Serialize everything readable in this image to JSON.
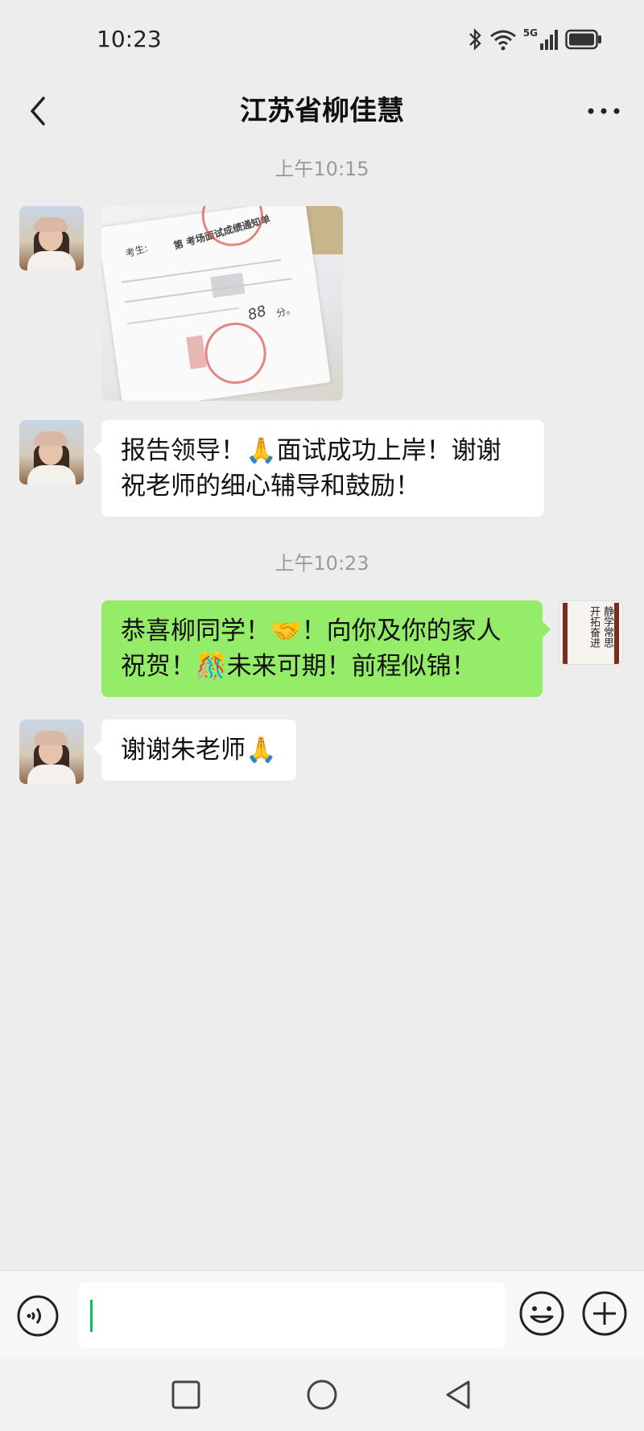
{
  "status_bar": {
    "time": "10:23",
    "network": "5G"
  },
  "header": {
    "title": "江苏省柳佳慧"
  },
  "messages": [
    {
      "type": "timestamp",
      "text": "上午10:15"
    },
    {
      "type": "image",
      "sender": "contact",
      "doc_text": {
        "candidate": "考生:",
        "heading": "第 考场面试成绩通知单",
        "score": "88",
        "unit": "分。"
      }
    },
    {
      "type": "text",
      "sender": "contact",
      "text": "报告领导！🙏面试成功上岸！谢谢祝老师的细心辅导和鼓励！"
    },
    {
      "type": "timestamp",
      "text": "上午10:23"
    },
    {
      "type": "text",
      "sender": "me",
      "text": "恭喜柳同学！🤝！向你及你的家人祝贺！🎊未来可期！前程似锦！"
    },
    {
      "type": "text",
      "sender": "contact",
      "text": "谢谢朱老师🙏"
    }
  ],
  "my_avatar": {
    "calligraphy": "静学常思 开拓奋进"
  },
  "input": {
    "value": ""
  },
  "colors": {
    "background": "#ededed",
    "my_bubble": "#95ec69",
    "their_bubble": "#ffffff",
    "accent": "#07c160"
  }
}
